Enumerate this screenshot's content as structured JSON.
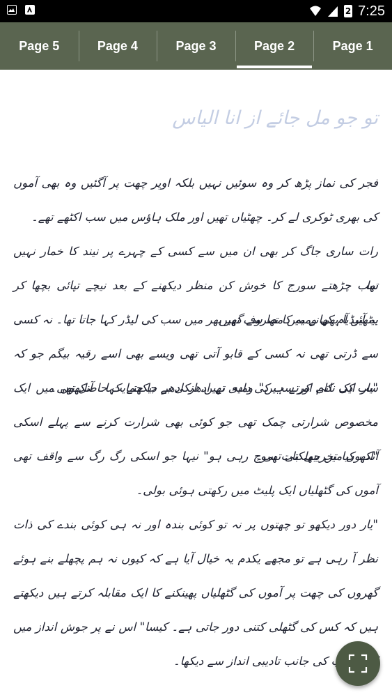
{
  "status_bar": {
    "time": "7:25",
    "battery_level": "2",
    "icons": [
      "image-icon",
      "app-notification-icon",
      "wifi-icon",
      "signal-icon",
      "battery-icon"
    ]
  },
  "tabs": [
    {
      "label": "Page 5",
      "active": false
    },
    {
      "label": "Page 4",
      "active": false
    },
    {
      "label": "Page 3",
      "active": false
    },
    {
      "label": "Page 2",
      "active": true
    },
    {
      "label": "Page 1",
      "active": false
    }
  ],
  "article": {
    "title": "تو جو مل جائے از انا الیاس",
    "paragraphs": [
      "فجر کی نماز پڑھ کر وہ سوئیں نہیں بلکہ اوپر چھت پر آگئیں وہ بھی آموں کی بھری ٹوکری لے کر۔ چھٹیاں تھیں اور ملک ہاؤس میں سب اکٹھے تھے۔",
      "رات ساری جاگ کر بھی ان میں سے کسی کے چہرے پر نیند کا خمار نہیں تھا۔",
      "سب چڑھتے سورج کا خوش کن منظر دیکھنے کے بعد نیچے تپائی بچھا کر بیٹھیں آم کھانے میں مصروف تھیں۔",
      "یہ آئیڈیا بھی ومیہ کا تھا سے گھر بھر میں سب کی لیڈر کہا جاتا تھا۔ نہ کسی سے ڈرتی تھی نہ کسی کے قابو آتی تھی ویسے بھی اسے رقیہ بیگم جو کہ سب کی نانی اور سب کی دادی تھیں، انکی بے جا حمایت حاصل تھی۔",
      "\"یار ایک کام کرتے ہیں\" ومیہ نے ادھر ادھر دیکھتے کہا۔ آنکھوں میں ایک مخصوص شرارتی چمک تھی جو کوئی بھی شرارت کرنے سے پہلے اسکی آنکھوں میں جھلکتی تھی۔",
      "\"اب کیا تخریبی بات سوچ رہی ہو\" نیہا جو اسکی رگ رگ سے واقف تھی آموں کی گٹھلیاں ایک پلیٹ میں رکھتی ہوئی بولی۔",
      "\"یار دور دیکھو تو چھتوں پر نہ تو کوئی بندہ اور نہ ہی کوئی بندے کی ذات نظر آ رہی ہے تو مجھے یکدم یہ خیال آیا ہے کہ کیوں نہ ہم پچھلے بنے ہوئے گھروں کی چھت پر آموں کی گٹھلیاں پھینکنے کا ایک مقابلہ کرتے ہیں دیکھتے ہیں کہ کس کی گٹھلی کتنی دور جاتی ہے۔ کیسا\" اس نے پر جوش انداز میں کہتے سب کی جانب تادیبی انداز سے دیکھا۔"
    ]
  },
  "fab": {
    "icon": "fullscreen-icon"
  },
  "colors": {
    "status_bar": "#000000",
    "tab_bar": "#5a6550",
    "tab_text": "#ffffff",
    "title": "#c3cde3",
    "body_text": "#1f2230",
    "fab": "#4d5a44"
  }
}
